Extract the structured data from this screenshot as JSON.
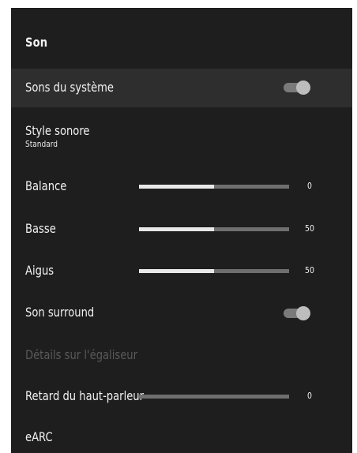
{
  "panel": {
    "title": "Son"
  },
  "items": {
    "system_sounds": {
      "label": "Sons du système",
      "toggle": true
    },
    "sound_style": {
      "label": "Style sonore",
      "value": "Standard"
    },
    "balance": {
      "label": "Balance",
      "value": "0",
      "level": 0.5
    },
    "bass": {
      "label": "Basse",
      "value": "50",
      "level": 0.5
    },
    "treble": {
      "label": "Aigus",
      "value": "50",
      "level": 0.5
    },
    "surround": {
      "label": "Son surround",
      "toggle": true
    },
    "equalizer": {
      "label": "Détails sur l'égaliseur",
      "enabled": false
    },
    "speaker_delay": {
      "label": "Retard du haut-parleur",
      "value": "0",
      "level": 0
    },
    "earc": {
      "label": "eARC"
    }
  }
}
